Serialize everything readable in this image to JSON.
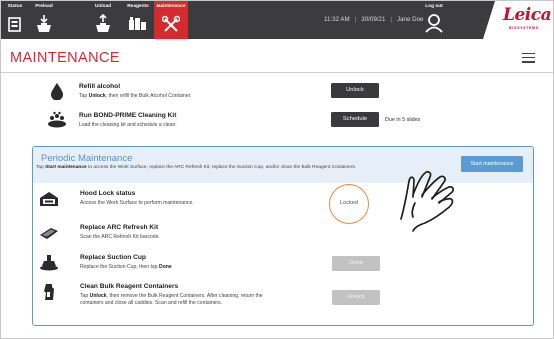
{
  "nav": {
    "tabs": [
      {
        "label": "Status",
        "icon": "status-icon"
      },
      {
        "label": "Preload",
        "icon": "preload-icon"
      },
      {
        "label": "Unload",
        "icon": "unload-icon"
      },
      {
        "label": "Reagents",
        "icon": "reagents-icon"
      },
      {
        "label": "Maintenance",
        "icon": "maintenance-icon",
        "active": true
      }
    ],
    "time": "11:32 AM",
    "date": "30/09/21",
    "user": "Jane Doe",
    "logout_label": "Log out",
    "brand": "Leica",
    "brand_sub": "BIOSYSTEMS",
    "active_color": "#d42b2f"
  },
  "page": {
    "title": "MAINTENANCE",
    "menu_icon": "hamburger-menu-icon"
  },
  "tasks": [
    {
      "title": "Refill alcohol",
      "desc_pre": "Tap ",
      "desc_kw": "Unlock",
      "desc_post": ", then refill the Bulk Alcohol Container.",
      "button": "Unlock",
      "icon": "alcohol-drop-icon"
    },
    {
      "title": "Run BOND-PRIME Cleaning Kit",
      "desc": "Load the cleaning kit and schedule a clean.",
      "button": "Schedule",
      "due": "Due in 5 slides",
      "icon": "cleaning-kit-icon"
    }
  ],
  "periodic": {
    "title": "Periodic Maintenance",
    "desc_pre": "Tap ",
    "desc_kw": "Start maintenance",
    "desc_post": " to access the Work Surface, replace the ARC Refresh Kit, replace the Suction Cup, and/or clean the Bulk Reagent Containers.",
    "start_button": "Start maintenance",
    "accent": "#5b9bd5",
    "items": [
      {
        "title": "Hood Lock status",
        "desc": "Access the Work Surface to perform maintenance.",
        "status": "Locked",
        "icon": "hood-lock-icon"
      },
      {
        "title": "Replace ARC Refresh Kit",
        "desc": "Scan the ARC Refresh Kit barcode.",
        "icon": "arc-refresh-kit-icon"
      },
      {
        "title": "Replace Suction Cup",
        "desc_pre": "Replace the Suction Cup, then tap ",
        "desc_kw": "Done",
        "button": "Done",
        "icon": "suction-cup-icon"
      },
      {
        "title": "Clean Bulk Reagent Containers",
        "desc1_pre": "Tap ",
        "desc1_kw": "Unlock",
        "desc1_post": ", then remove the Bulk Reagent Containers. After cleaning, return the",
        "desc2": "containers and close all caddies. Scan and refill the containers.",
        "button": "Unlock",
        "icon": "reagent-container-icon"
      }
    ]
  },
  "overlay": {
    "icon": "tap-hand-icon",
    "highlight_color": "#ef8a3a"
  }
}
